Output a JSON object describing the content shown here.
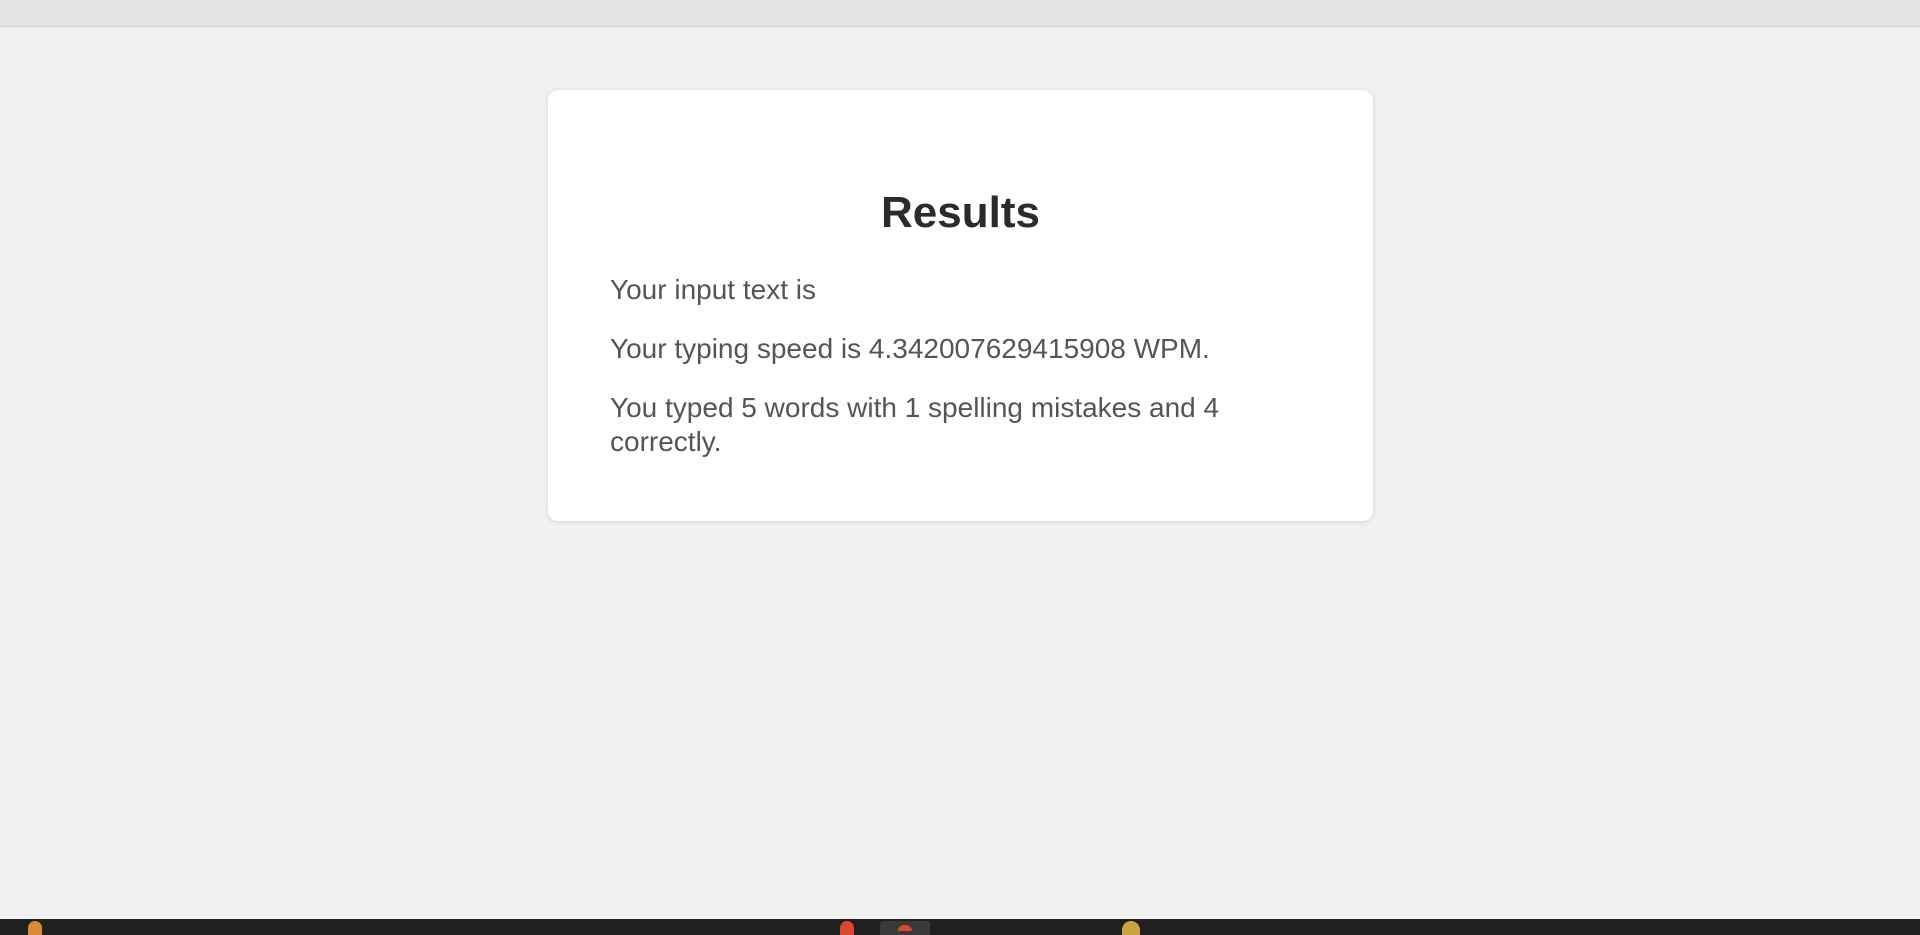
{
  "results": {
    "title": "Results",
    "input_text_line": "Your input text is",
    "speed_line": "Your typing speed is 4.342007629415908 WPM.",
    "summary_line": "You typed 5 words with 1 spelling mistakes and 4 correctly."
  },
  "colors": {
    "background": "#f1f1f1",
    "card": "#ffffff",
    "title_text": "#2b2b2b",
    "body_text": "#555555",
    "taskbar": "#202020"
  },
  "taskbar": {
    "icons": [
      "weather-icon",
      "app-icon",
      "app-icon-active",
      "app-icon-notification"
    ]
  }
}
